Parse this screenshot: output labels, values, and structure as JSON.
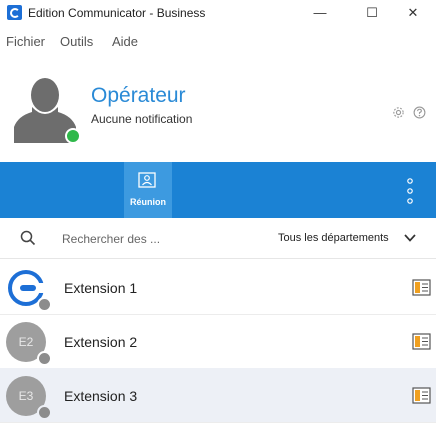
{
  "window": {
    "title": "Edition Communicator - Business",
    "minimize": "—",
    "maximize": "☐",
    "close": "✕"
  },
  "menu": [
    "Fichier",
    "Outils",
    "Aide"
  ],
  "profile": {
    "name": "Opérateur",
    "status_text": "Aucune notification",
    "presence_color": "#2fb84a"
  },
  "tabs": [
    {
      "label": "Réunion",
      "icon": "meeting-icon",
      "active": true
    }
  ],
  "search": {
    "placeholder": "Rechercher des ...",
    "department_filter": "Tous les départements"
  },
  "contacts": [
    {
      "name": "Extension 1",
      "initials": "",
      "avatar": "app-logo"
    },
    {
      "name": "Extension 2",
      "initials": "E2",
      "avatar": "initials"
    },
    {
      "name": "Extension 3",
      "initials": "E3",
      "avatar": "initials"
    }
  ],
  "colors": {
    "accent": "#1b82d4",
    "tab_active": "#3d9ae0",
    "title_blue": "#2a8ad6",
    "card_orange": "#f0a020"
  }
}
